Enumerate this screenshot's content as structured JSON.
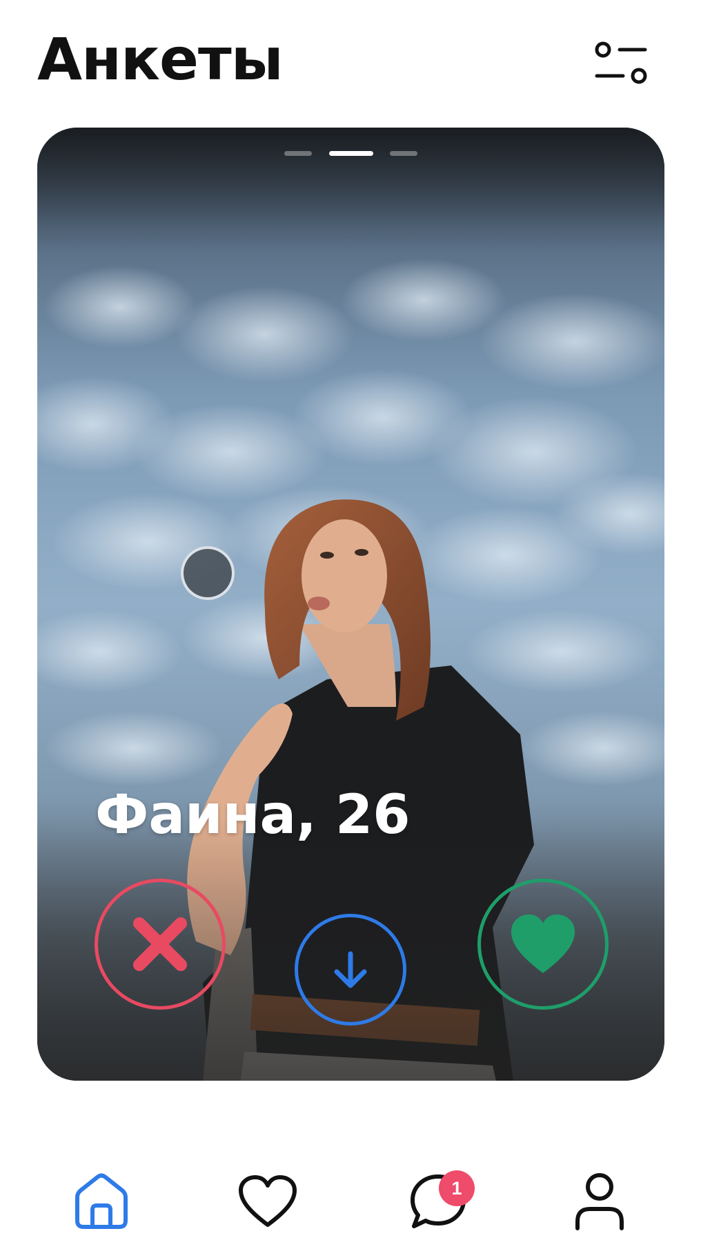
{
  "header": {
    "title": "Анкеты",
    "filter_icon": "sliders-icon"
  },
  "card": {
    "name_age": "Фаина, 26",
    "photo_count": 3,
    "active_photo_index": 1,
    "actions": {
      "dislike_icon": "x-icon",
      "more_icon": "arrow-down-icon",
      "like_icon": "heart-icon"
    }
  },
  "colors": {
    "dislike": "#e84a62",
    "more": "#2e7be8",
    "like": "#1f9e6a",
    "nav_active": "#2e7be8",
    "badge": "#ef4b6a"
  },
  "nav": {
    "items": [
      {
        "icon": "home-icon",
        "active": true
      },
      {
        "icon": "heart-outline-icon",
        "active": false
      },
      {
        "icon": "chat-bubble-icon",
        "active": false,
        "badge": "1"
      },
      {
        "icon": "profile-icon",
        "active": false
      }
    ]
  }
}
